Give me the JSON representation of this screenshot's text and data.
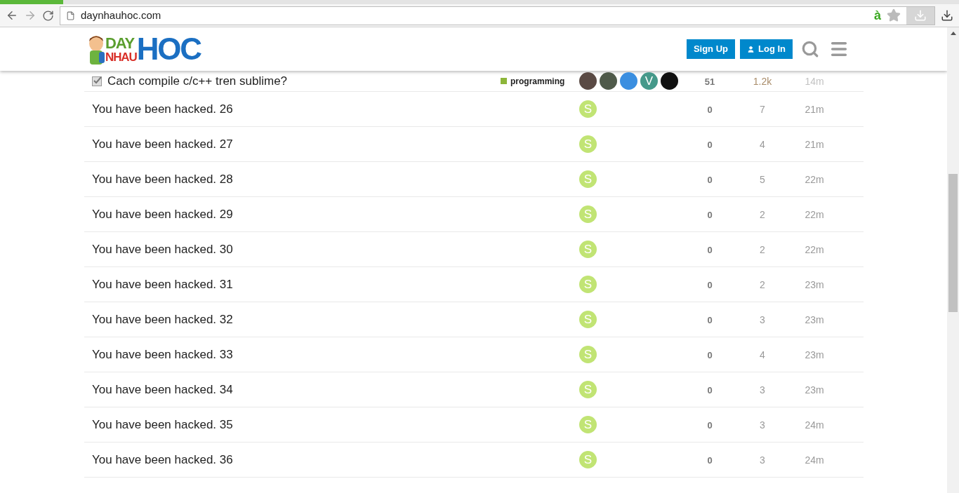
{
  "browser": {
    "url": "daynhauhoc.com",
    "extension_label": "à"
  },
  "header": {
    "logo": {
      "top": "DAY",
      "bottom": "NHAU",
      "big": "HOC"
    },
    "buttons": [
      {
        "kind": "signup",
        "label": "Sign Up"
      },
      {
        "kind": "login",
        "label": "Log In"
      }
    ]
  },
  "topics": [
    {
      "title": "Cach compile c/c++ tren sublime?",
      "solved": true,
      "category": {
        "name": "programming",
        "color": "#8db63a"
      },
      "posters": [
        {
          "kind": "photo",
          "color": "#5a4a44"
        },
        {
          "kind": "photo",
          "color": "#4f5a4a"
        },
        {
          "kind": "photo",
          "color": "#3a8ee0"
        },
        {
          "kind": "letter",
          "letter": "V",
          "color": "#45998a"
        },
        {
          "kind": "photo",
          "color": "#111111"
        }
      ],
      "replies": "51",
      "views": "1.2k",
      "hot": true,
      "activity": "14m"
    },
    {
      "title": "You have been hacked. 26",
      "solved": false,
      "posters": [
        {
          "kind": "letter",
          "letter": "S",
          "color": "#c1e474"
        }
      ],
      "replies": "0",
      "views": "7",
      "hot": false,
      "activity": "21m"
    },
    {
      "title": "You have been hacked. 27",
      "solved": false,
      "posters": [
        {
          "kind": "letter",
          "letter": "S",
          "color": "#c1e474"
        }
      ],
      "replies": "0",
      "views": "4",
      "hot": false,
      "activity": "21m"
    },
    {
      "title": "You have been hacked. 28",
      "solved": false,
      "posters": [
        {
          "kind": "letter",
          "letter": "S",
          "color": "#c1e474"
        }
      ],
      "replies": "0",
      "views": "5",
      "hot": false,
      "activity": "22m"
    },
    {
      "title": "You have been hacked. 29",
      "solved": false,
      "posters": [
        {
          "kind": "letter",
          "letter": "S",
          "color": "#c1e474"
        }
      ],
      "replies": "0",
      "views": "2",
      "hot": false,
      "activity": "22m"
    },
    {
      "title": "You have been hacked. 30",
      "solved": false,
      "posters": [
        {
          "kind": "letter",
          "letter": "S",
          "color": "#c1e474"
        }
      ],
      "replies": "0",
      "views": "2",
      "hot": false,
      "activity": "22m"
    },
    {
      "title": "You have been hacked. 31",
      "solved": false,
      "posters": [
        {
          "kind": "letter",
          "letter": "S",
          "color": "#c1e474"
        }
      ],
      "replies": "0",
      "views": "2",
      "hot": false,
      "activity": "23m"
    },
    {
      "title": "You have been hacked. 32",
      "solved": false,
      "posters": [
        {
          "kind": "letter",
          "letter": "S",
          "color": "#c1e474"
        }
      ],
      "replies": "0",
      "views": "3",
      "hot": false,
      "activity": "23m"
    },
    {
      "title": "You have been hacked. 33",
      "solved": false,
      "posters": [
        {
          "kind": "letter",
          "letter": "S",
          "color": "#c1e474"
        }
      ],
      "replies": "0",
      "views": "4",
      "hot": false,
      "activity": "23m"
    },
    {
      "title": "You have been hacked. 34",
      "solved": false,
      "posters": [
        {
          "kind": "letter",
          "letter": "S",
          "color": "#c1e474"
        }
      ],
      "replies": "0",
      "views": "3",
      "hot": false,
      "activity": "23m"
    },
    {
      "title": "You have been hacked. 35",
      "solved": false,
      "posters": [
        {
          "kind": "letter",
          "letter": "S",
          "color": "#c1e474"
        }
      ],
      "replies": "0",
      "views": "3",
      "hot": false,
      "activity": "24m"
    },
    {
      "title": "You have been hacked. 36",
      "solved": false,
      "posters": [
        {
          "kind": "letter",
          "letter": "S",
          "color": "#c1e474"
        }
      ],
      "replies": "0",
      "views": "3",
      "hot": false,
      "activity": "24m"
    }
  ]
}
